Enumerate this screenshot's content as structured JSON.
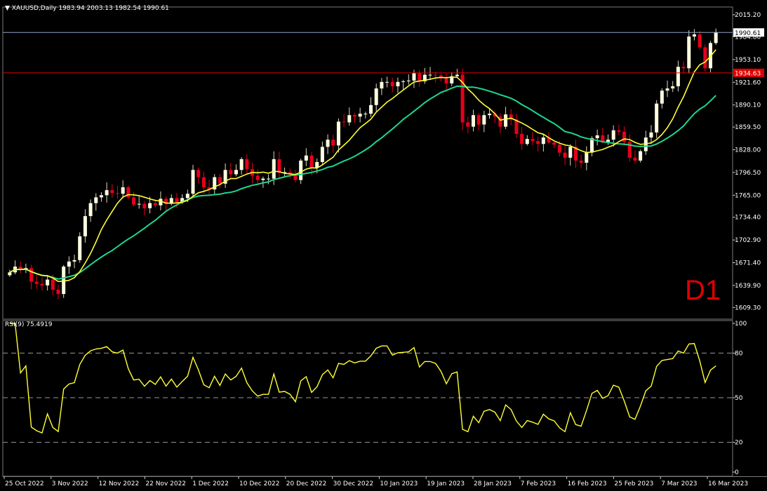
{
  "header": {
    "symbol": "XAUUSD,Daily",
    "ohlc": "1983.94 2003.13 1982.54 1990.61",
    "rsi_label": "RSI(9) 75.4919"
  },
  "timeframe_badge": "D1",
  "colors": {
    "background": "#000000",
    "bull_candle": "#ffffe0",
    "bear_candle": "#e8001c",
    "ma_fast": "#ffff33",
    "ma_slow": "#1fd68f",
    "rsi_line": "#ffff33",
    "bid_line": "#8fa4c8",
    "level_line": "#e00000"
  },
  "chart_data": [
    {
      "type": "candlestick",
      "title": "XAUUSD,Daily",
      "ylim": [
        1598,
        2023
      ],
      "y_ticks": [
        "2015.20",
        "1984.80",
        "1953.10",
        "1921.60",
        "1890.10",
        "1859.50",
        "1828.00",
        "1796.50",
        "1765.00",
        "1734.40",
        "1702.90",
        "1671.40",
        "1639.90",
        "1609.30"
      ],
      "x_ticks": [
        "25 Oct 2022",
        "3 Nov 2022",
        "12 Nov 2022",
        "22 Nov 2022",
        "1 Dec 2022",
        "10 Dec 2022",
        "20 Dec 2022",
        "30 Dec 2022",
        "10 Jan 2023",
        "19 Jan 2023",
        "28 Jan 2023",
        "7 Feb 2023",
        "16 Feb 2023",
        "25 Feb 2023",
        "7 Mar 2023",
        "16 Mar 2023"
      ],
      "price_labels": {
        "bid": "1990.61",
        "level": "1934.63"
      },
      "levels": {
        "bid": 1990.61,
        "level": 1934.63
      },
      "closes": [
        1658,
        1666,
        1662,
        1664,
        1645,
        1642,
        1640,
        1648,
        1634,
        1628,
        1666,
        1673,
        1675,
        1708,
        1736,
        1754,
        1762,
        1765,
        1772,
        1768,
        1767,
        1776,
        1762,
        1752,
        1753,
        1747,
        1754,
        1751,
        1760,
        1753,
        1761,
        1755,
        1761,
        1767,
        1800,
        1790,
        1776,
        1773,
        1790,
        1781,
        1800,
        1794,
        1800,
        1815,
        1801,
        1792,
        1786,
        1788,
        1788,
        1815,
        1796,
        1797,
        1794,
        1786,
        1813,
        1820,
        1803,
        1811,
        1832,
        1842,
        1834,
        1867,
        1866,
        1876,
        1874,
        1878,
        1878,
        1890,
        1913,
        1922,
        1922,
        1916,
        1922,
        1923,
        1924,
        1934,
        1923,
        1932,
        1932,
        1931,
        1927,
        1920,
        1930,
        1932,
        1866,
        1860,
        1876,
        1863,
        1876,
        1878,
        1874,
        1860,
        1877,
        1870,
        1850,
        1836,
        1843,
        1840,
        1836,
        1845,
        1838,
        1835,
        1824,
        1817,
        1832,
        1813,
        1810,
        1824,
        1844,
        1848,
        1839,
        1842,
        1855,
        1853,
        1839,
        1817,
        1813,
        1826,
        1845,
        1852,
        1892,
        1910,
        1913,
        1916,
        1943,
        1941,
        1985,
        1988,
        1970,
        1941,
        1976,
        1990.61
      ],
      "rsi_ylim": [
        0,
        100
      ],
      "rsi_levels": [
        80,
        50,
        20
      ],
      "rsi_ticks": [
        "100",
        "80",
        "50",
        "20",
        "0"
      ],
      "rsi_last": 75.4919
    }
  ]
}
